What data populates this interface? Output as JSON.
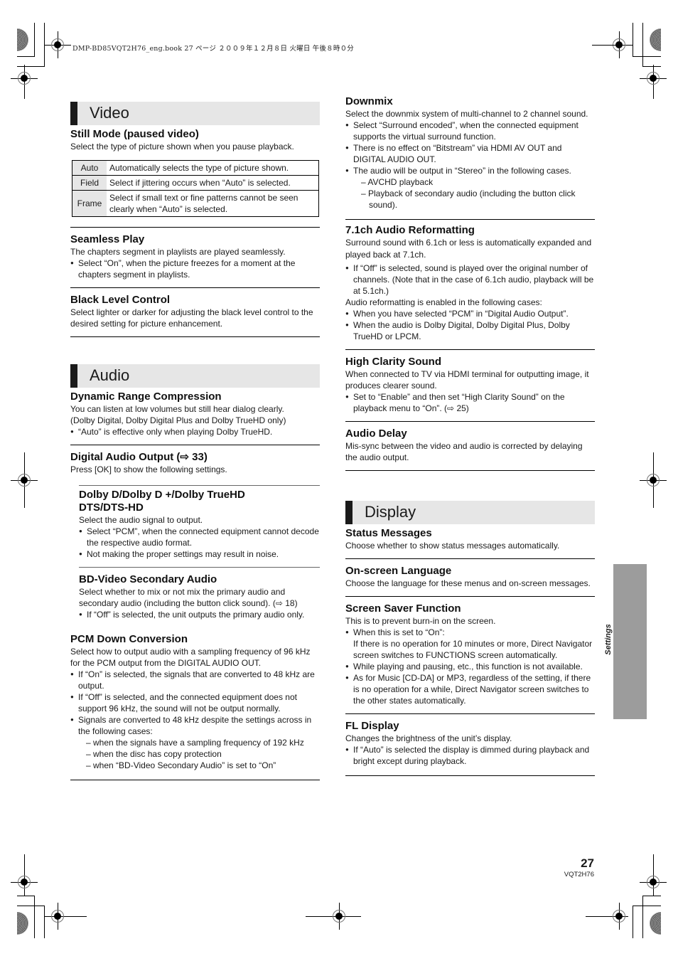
{
  "book_header": "DMP-BD85VQT2H76_eng.book  27 ページ  ２００９年１２月８日  火曜日  午後８時０分",
  "left_column": {
    "video_section": {
      "title": "Video",
      "still_mode": {
        "heading": "Still Mode (paused video)",
        "text": "Select the type of picture shown when you pause playback.",
        "options": [
          {
            "key": "Auto",
            "desc": "Automatically selects the type of picture shown."
          },
          {
            "key": "Field",
            "desc": "Select if jittering occurs when “Auto” is selected."
          },
          {
            "key": "Frame",
            "desc": "Select if small text or fine patterns cannot be seen clearly when “Auto” is selected."
          }
        ]
      },
      "seamless_play": {
        "heading": "Seamless Play",
        "text": "The chapters segment in playlists are played seamlessly.",
        "bullets": [
          "Select “On”, when the picture freezes for a moment at the chapters segment in playlists."
        ]
      },
      "black_level": {
        "heading": "Black Level Control",
        "text": "Select lighter or darker for adjusting the black level control to the desired setting for picture enhancement."
      }
    },
    "audio_section": {
      "title": "Audio",
      "drc": {
        "heading": "Dynamic Range Compression",
        "text1": "You can listen at low volumes but still hear dialog clearly.",
        "text2": "(Dolby Digital, Dolby Digital Plus and Dolby TrueHD only)",
        "bullets": [
          "“Auto” is effective only when playing Dolby TrueHD."
        ]
      },
      "digital_out": {
        "heading": "Digital Audio Output (⇨ 33)",
        "text": "Press [OK] to show the following settings."
      },
      "dolby": {
        "heading1": "Dolby D/Dolby D +/Dolby TrueHD",
        "heading2": "DTS/DTS-HD",
        "text": "Select the audio signal to output.",
        "bullets": [
          "Select “PCM”, when the connected equipment cannot decode the respective audio format.",
          "Not making the proper settings may result in noise."
        ]
      },
      "bd_secondary": {
        "heading": "BD-Video Secondary Audio",
        "text": "Select whether to mix or not mix the primary audio and secondary audio (including the button click sound). (⇨ 18)",
        "bullets": [
          "If “Off” is selected, the unit outputs the primary audio only."
        ]
      },
      "pcm_down": {
        "heading": "PCM Down Conversion",
        "text": "Select how to output audio with a sampling frequency of 96 kHz for the PCM output from the DIGITAL AUDIO OUT.",
        "bullets": [
          "If “On” is selected, the signals that are converted to 48 kHz are output.",
          "If “Off” is selected, and the connected equipment does not support 96 kHz, the sound will not be output normally.",
          "Signals are converted to 48 kHz despite the settings across in the following cases:"
        ],
        "dashes": [
          "– when the signals have a sampling frequency of 192 kHz",
          "– when the disc has copy protection",
          "– when “BD-Video Secondary Audio” is set to “On”"
        ]
      }
    }
  },
  "right_column": {
    "downmix": {
      "heading": "Downmix",
      "text": "Select the downmix system of multi-channel to 2 channel sound.",
      "bullets": [
        "Select “Surround encoded”, when the connected equipment supports the virtual surround function.",
        "There is no effect on “Bitstream” via HDMI AV OUT and DIGITAL AUDIO OUT.",
        "The audio will be output in “Stereo” in the following cases."
      ],
      "dashes": [
        "– AVCHD playback",
        "– Playback of secondary audio (including the button click sound)."
      ]
    },
    "reformat": {
      "heading": "7.1ch Audio Reformatting",
      "text": "Surround sound with 6.1ch or less is automatically expanded and played back at 7.1ch.",
      "bullet1": "If “Off” is selected, sound is played over the original number of channels. (Note that in the case of 6.1ch audio, playback will be at 5.1ch.)",
      "text2": "Audio reformatting is enabled in the following cases:",
      "bullets2": [
        "When you have selected “PCM” in “Digital Audio Output”.",
        "When the audio is Dolby Digital, Dolby Digital Plus, Dolby TrueHD or LPCM."
      ]
    },
    "high_clarity": {
      "heading": "High Clarity Sound",
      "text": "When connected to TV via HDMI terminal for outputting image, it produces clearer sound.",
      "bullets": [
        "Set to “Enable” and then set “High Clarity Sound” on the playback menu to “On”. (⇨ 25)"
      ]
    },
    "audio_delay": {
      "heading": "Audio Delay",
      "text": "Mis-sync between the video and audio is corrected by delaying the audio output."
    },
    "display_section": {
      "title": "Display",
      "status": {
        "heading": "Status Messages",
        "text": "Choose whether to show status messages automatically."
      },
      "language": {
        "heading": "On-screen Language",
        "text": "Choose the language for these menus and on-screen messages."
      },
      "screensaver": {
        "heading": "Screen Saver Function",
        "text": "This is to prevent burn-in on the screen.",
        "bullet1": "When this is set to “On”:",
        "bullet1_cont": "If there is no operation for 10 minutes or more, Direct Navigator screen switches to FUNCTIONS screen automatically.",
        "bullets": [
          "While playing and pausing, etc., this function is not available.",
          "As for Music [CD-DA] or MP3, regardless of the setting, if there is no operation for a while, Direct Navigator screen switches to the other states automatically."
        ]
      },
      "fl_display": {
        "heading": "FL Display",
        "text": "Changes the brightness of the unit’s display.",
        "bullets": [
          "If “Auto” is selected the display is dimmed during playback and bright except during playback."
        ]
      }
    }
  },
  "side_tab": {
    "label": "Settings",
    "color": "#9c9c9c"
  },
  "footer": {
    "page_number": "27",
    "code": "VQT2H76"
  }
}
